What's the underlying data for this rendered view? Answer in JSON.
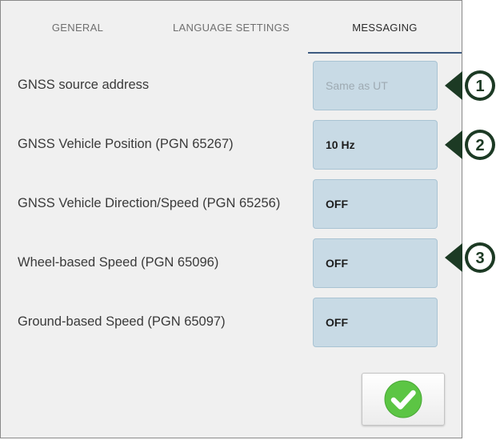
{
  "tabs": [
    {
      "label": "GENERAL",
      "active": false
    },
    {
      "label": "LANGUAGE SETTINGS",
      "active": false
    },
    {
      "label": "MESSAGING",
      "active": true
    }
  ],
  "rows": [
    {
      "label": "GNSS source address",
      "value": "Same as UT",
      "disabled": true
    },
    {
      "label": "GNSS Vehicle Position (PGN 65267)",
      "value": "10 Hz",
      "disabled": false
    },
    {
      "label": "GNSS Vehicle Direction/Speed (PGN 65256)",
      "value": "OFF",
      "disabled": false
    },
    {
      "label": "Wheel-based Speed (PGN 65096)",
      "value": "OFF",
      "disabled": false
    },
    {
      "label": "Ground-based Speed (PGN 65097)",
      "value": "OFF",
      "disabled": false
    }
  ],
  "callouts": [
    "1",
    "2",
    "3"
  ],
  "colors": {
    "tab_underline": "#3d5a80",
    "field_bg": "#c8dae5",
    "check_green": "#5cc544",
    "callout_dark": "#1c3a24"
  },
  "icons": {
    "ok_button": "checkmark-icon",
    "callout": "arrow-left-callout-icon"
  }
}
